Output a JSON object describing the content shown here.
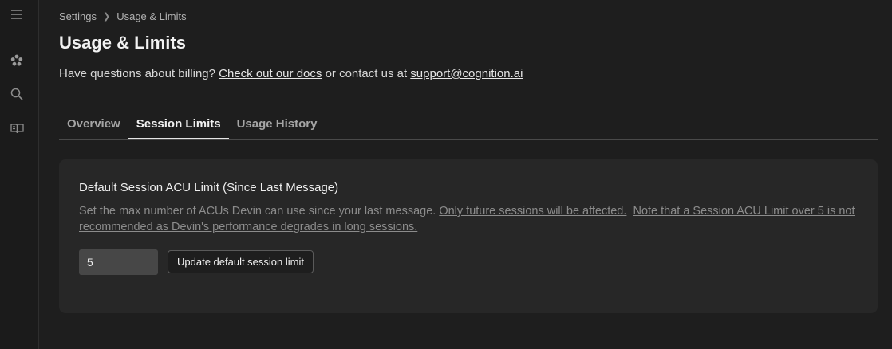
{
  "breadcrumb": {
    "parent": "Settings",
    "current": "Usage & Limits"
  },
  "page": {
    "title": "Usage & Limits",
    "subtitle_prefix": "Have questions about billing?",
    "docs_link": "Check out our docs",
    "subtitle_mid": "or contact us at",
    "support_email": "support@cognition.ai"
  },
  "tabs": [
    {
      "label": "Overview",
      "active": false
    },
    {
      "label": "Session Limits",
      "active": true
    },
    {
      "label": "Usage History",
      "active": false
    }
  ],
  "session_limit": {
    "heading": "Default Session ACU Limit (Since Last Message)",
    "description": "Set the max number of ACUs Devin can use since your last message.",
    "note1": "Only future sessions will be affected.",
    "note2": "Note that a Session ACU Limit over 5 is not recommended as Devin's performance degrades in long sessions.",
    "input_value": "5",
    "button_label": "Update default session limit"
  },
  "icons": [
    "menu-icon",
    "devin-logo-icon",
    "search-icon",
    "docs-book-icon"
  ]
}
